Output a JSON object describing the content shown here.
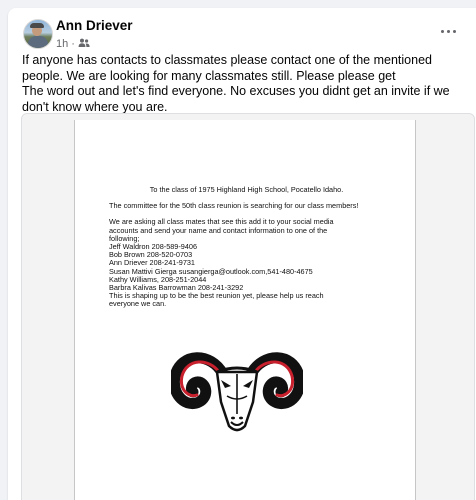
{
  "post": {
    "author": "Ann Driever",
    "time": "1h",
    "privacy_icon": "friends-icon",
    "more_icon": "more-horizontal-icon",
    "text_lines": [
      "If anyone has contacts to classmates please contact one of the mentioned people. We are looking for many classmates still. Please please get",
      "The word out and let's find everyone. No excuses you didnt get an invite if we don't know where you are."
    ]
  },
  "attachment": {
    "title": "To the class of 1975 Highland High School, Pocatello Idaho.",
    "paragraph1": "The committee for the 50th class reunion is searching for our class members!",
    "paragraph2_lines": [
      "We are asking all class mates that see this add it to your social media",
      "accounts and send your name and contact information to one of the",
      "following;",
      "Jeff Waldron 208-589-9406",
      "Bob Brown 208-520-0703",
      "Ann Driever 208-241-9731",
      "Susan Mattivi Gierga susangierga@outlook.com,541-480-4675",
      "Kathy Williams, 208-251-2044",
      "Barbra Kalivas Barrowman 208-241-3292",
      "This is shaping up to be the best reunion yet, please help us reach",
      "everyone we can."
    ],
    "logo": "ram-mascot-logo"
  },
  "colors": {
    "page_bg": "#f0f2f5",
    "card_bg": "#ffffff",
    "secondary_text": "#65676b",
    "ram_accent": "#c8202c"
  }
}
